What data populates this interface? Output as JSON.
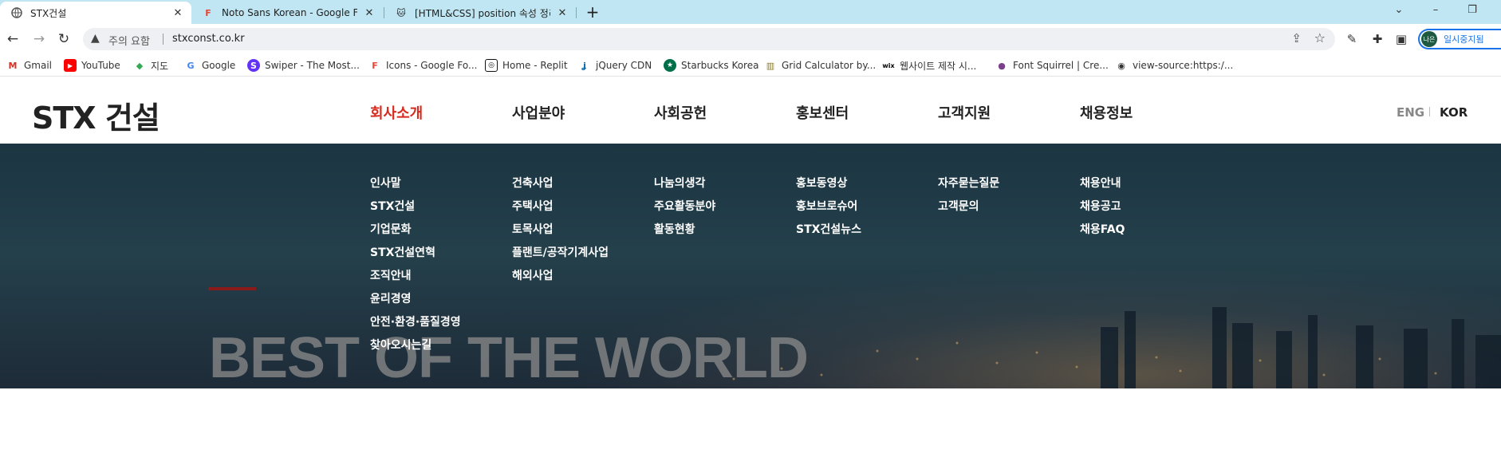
{
  "browser": {
    "tabs": [
      {
        "title": "STX건설",
        "icon": "globe-icon",
        "active": true
      },
      {
        "title": "Noto Sans Korean - Google For",
        "icon": "google-fonts-icon",
        "active": false
      },
      {
        "title": "[HTML&CSS] position 속성 정리",
        "icon": "cat-icon",
        "active": false
      }
    ],
    "new_tab": "+",
    "window_controls": {
      "chevron": "⌄",
      "minimize": "–",
      "restore": "❐"
    },
    "address": {
      "warning_text": "주의 요함",
      "url": "stxconst.co.kr"
    },
    "profile": {
      "avatar_text": "나은",
      "label": "일시중지됨"
    },
    "bookmarks": [
      {
        "label": "Gmail",
        "icon": "gmail-icon",
        "color": "#d93025"
      },
      {
        "label": "YouTube",
        "icon": "youtube-icon",
        "color": "#ff0000"
      },
      {
        "label": "지도",
        "icon": "maps-icon",
        "color": "#34a853"
      },
      {
        "label": "Google",
        "icon": "google-icon",
        "color": "#4285f4"
      },
      {
        "label": "Swiper - The Most...",
        "icon": "swiper-icon",
        "color": "#6332f6"
      },
      {
        "label": "Icons - Google Fo...",
        "icon": "google-fonts-icon",
        "color": "#ea4335"
      },
      {
        "label": "Home - Replit",
        "icon": "replit-icon",
        "color": "#111111"
      },
      {
        "label": "jQuery CDN",
        "icon": "jquery-icon",
        "color": "#0769ad"
      },
      {
        "label": "Starbucks Korea",
        "icon": "starbucks-icon",
        "color": "#00704a"
      },
      {
        "label": "Grid Calculator by...",
        "icon": "grid-icon",
        "color": "#8a7a2a"
      },
      {
        "label": "웹사이트 제작 시...",
        "icon": "wix-icon",
        "color": "#000000"
      },
      {
        "label": "Font Squirrel | Cre...",
        "icon": "squirrel-icon",
        "color": "#7b3f8c"
      },
      {
        "label": "view-source:https:/...",
        "icon": "globe-icon",
        "color": "#333333"
      }
    ]
  },
  "site": {
    "logo": "STX 건설",
    "gnb": [
      {
        "label": "회사소개",
        "active": true,
        "sub": [
          "인사말",
          "STX건설",
          "기업문화",
          "STX건설연혁",
          "조직안내",
          "윤리경영",
          "안전·환경·품질경영",
          "찾아오시는길"
        ]
      },
      {
        "label": "사업분야",
        "active": false,
        "sub": [
          "건축사업",
          "주택사업",
          "토목사업",
          "플랜트/공작기계사업",
          "해외사업"
        ]
      },
      {
        "label": "사회공헌",
        "active": false,
        "sub": [
          "나눔의생각",
          "주요활동분야",
          "활동현황"
        ]
      },
      {
        "label": "홍보센터",
        "active": false,
        "sub": [
          "홍보동영상",
          "홍보브로슈어",
          "STX건설뉴스"
        ]
      },
      {
        "label": "고객지원",
        "active": false,
        "sub": [
          "자주묻는질문",
          "고객문의"
        ]
      },
      {
        "label": "채용정보",
        "active": false,
        "sub": [
          "채용안내",
          "채용공고",
          "채용FAQ"
        ]
      }
    ],
    "lang": {
      "eng": "ENG",
      "kor": "KOR"
    },
    "hero": {
      "slogan": "BEST OF THE WORLD"
    },
    "colors": {
      "accent": "#d62a1e",
      "redbar": "#8b1a1a"
    }
  }
}
